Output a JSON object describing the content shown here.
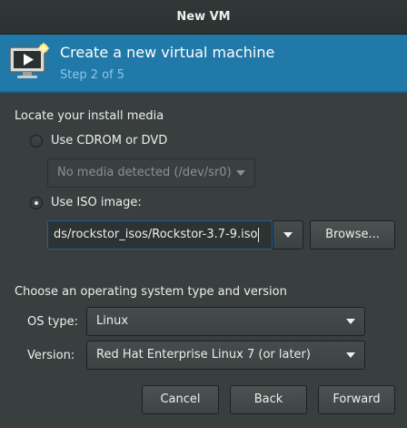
{
  "window": {
    "title": "New VM"
  },
  "header": {
    "title": "Create a new virtual machine",
    "step": "Step 2 of 5",
    "icon": "vm-monitor-icon",
    "colors": {
      "band": "#2079a9",
      "step_text": "#8fc5e6"
    }
  },
  "install_media": {
    "section_label": "Locate your install media",
    "cdrom": {
      "label": "Use CDROM or DVD",
      "selected": false,
      "combo_value": "No media detected (/dev/sr0)"
    },
    "iso": {
      "label": "Use ISO image:",
      "selected": true,
      "path_value": "ds/rockstor_isos/Rockstor-3.7-9.iso",
      "browse_label": "Browse..."
    }
  },
  "os": {
    "section_label": "Choose an operating system type and version",
    "type_label": "OS type:",
    "type_value": "Linux",
    "version_label": "Version:",
    "version_value": "Red Hat Enterprise Linux 7 (or later)"
  },
  "footer": {
    "cancel_label": "Cancel",
    "back_label": "Back",
    "forward_label": "Forward"
  }
}
